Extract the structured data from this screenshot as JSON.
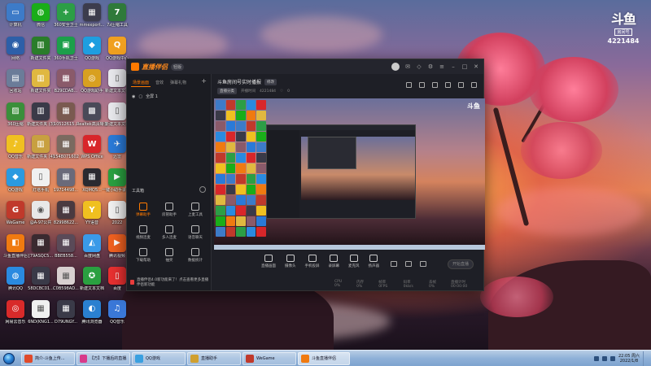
{
  "desktop": {
    "icons": [
      {
        "label": "计算机",
        "color": "#3d7bc8",
        "glyph": "▭"
      },
      {
        "label": "微信",
        "color": "#1aad19",
        "glyph": "◍"
      },
      {
        "label": "360安全卫士",
        "color": "#2c9e46",
        "glyph": "+"
      },
      {
        "label": "mmexport...",
        "color": "#3c3c4c",
        "glyph": "▦"
      },
      {
        "label": "7z压缩工具",
        "color": "#2f7a3a",
        "glyph": "7"
      },
      {
        "label": "网络",
        "color": "#2d5fa8",
        "glyph": "◉"
      },
      {
        "label": "新建文件夹",
        "color": "#2a7d2a",
        "glyph": "▥"
      },
      {
        "label": "360手机卫士",
        "color": "#1c9f4a",
        "glyph": "▣"
      },
      {
        "label": "QQ游戏",
        "color": "#1e9ee0",
        "glyph": "◆"
      },
      {
        "label": "QQ游戏中心",
        "color": "#f0a020",
        "glyph": "Q"
      },
      {
        "label": "回收站",
        "color": "#6b7c99",
        "glyph": "▤"
      },
      {
        "label": "新建文件夹",
        "color": "#e0b840",
        "glyph": "▥"
      },
      {
        "label": "B29CDAB...",
        "color": "#8a5a6a",
        "glyph": "▦"
      },
      {
        "label": "QQ游戏助手",
        "color": "#d8a020",
        "glyph": "◎"
      },
      {
        "label": "新建文本文档",
        "color": "#e8e8ec",
        "glyph": "▯"
      },
      {
        "label": "360压缩",
        "color": "#3a8f3a",
        "glyph": "▨"
      },
      {
        "label": "新建文件夹 (3)",
        "color": "#3a3a48",
        "glyph": "▥"
      },
      {
        "label": "10512615...",
        "color": "#7a5a50",
        "glyph": "▦"
      },
      {
        "label": "Realtek高清晰音频管理器",
        "color": "#4a4a58",
        "glyph": "▩"
      },
      {
        "label": "新建文本文档",
        "color": "#e8e8ec",
        "glyph": "▯"
      },
      {
        "label": "QQ音乐",
        "color": "#f0c020",
        "glyph": "♪"
      },
      {
        "label": "新建文件夹 (4)",
        "color": "#c8a040",
        "glyph": "▥"
      },
      {
        "label": "1548071602",
        "color": "#7a6a60",
        "glyph": "▦"
      },
      {
        "label": "WPS Office",
        "color": "#d8262a",
        "glyph": "W"
      },
      {
        "label": "迅雷",
        "color": "#2a7ad8",
        "glyph": "✈"
      },
      {
        "label": "QQ游戏",
        "color": "#2a9ae0",
        "glyph": "◆"
      },
      {
        "label": "灯塔手机",
        "color": "#f0f0f0",
        "glyph": "▯"
      },
      {
        "label": "19714498...",
        "color": "#6a6a7a",
        "glyph": "▦"
      },
      {
        "label": "XQMQ5...",
        "color": "#2a2a30",
        "glyph": "▦"
      },
      {
        "label": "一键小助手录像视频编辑",
        "color": "#2aa040",
        "glyph": "▶"
      },
      {
        "label": "WeGame",
        "color": "#c0392b",
        "glyph": "G"
      },
      {
        "label": "@A-97公共",
        "color": "#e8e8e8",
        "glyph": "◉"
      },
      {
        "label": "82998622...",
        "color": "#4a3a40",
        "glyph": "▦"
      },
      {
        "label": "YY语音",
        "color": "#f0c020",
        "glyph": "Y"
      },
      {
        "label": "2022",
        "color": "#f0f0f0",
        "glyph": "▯"
      },
      {
        "label": "斗鱼直播伴侣",
        "color": "#f07a10",
        "glyph": "◧"
      },
      {
        "label": "[79ASQC5...",
        "color": "#3a2a30",
        "glyph": "▦"
      },
      {
        "label": "BBEB558...",
        "color": "#5a4a58",
        "glyph": "▦"
      },
      {
        "label": "百度网盘",
        "color": "#3a9ae8",
        "glyph": "◭"
      },
      {
        "label": "腾讯视频",
        "color": "#f06020",
        "glyph": "▶"
      },
      {
        "label": "腾讯QQ",
        "color": "#2a8ae0",
        "glyph": "◍"
      },
      {
        "label": "58DCBC01...",
        "color": "#3a3a48",
        "glyph": "▦"
      },
      {
        "label": "C0B598AD...",
        "color": "#d8d0d0",
        "glyph": "▦"
      },
      {
        "label": "新建文本文档",
        "color": "#2aa040",
        "glyph": "✪"
      },
      {
        "label": "百度",
        "color": "#e83030",
        "glyph": "▯"
      },
      {
        "label": "网易云音乐",
        "color": "#d82a2a",
        "glyph": "◎"
      },
      {
        "label": "6ND(KNG1...",
        "color": "#f0f0f0",
        "glyph": "▦"
      },
      {
        "label": "D79UNGY...",
        "color": "#3a3a48",
        "glyph": "▦"
      },
      {
        "label": "腾讯浏览器",
        "color": "#2a80d0",
        "glyph": "◐"
      },
      {
        "label": "QQ音乐",
        "color": "#3a78d8",
        "glyph": "♫"
      }
    ]
  },
  "douyu": {
    "logo": "斗鱼",
    "room_tag": "房间号",
    "room_id": "4221484"
  },
  "app": {
    "title": "直播伴侣",
    "version_badge": "轻版",
    "tabs": [
      "场景画面",
      "音效",
      "弹幕礼物"
    ],
    "tab_add": "+",
    "scene_item": "全屏 1",
    "toolbox_label": "工具箱",
    "tools": [
      {
        "label": "弹幕助手",
        "hot": true
      },
      {
        "label": "房管助手",
        "hot": false
      },
      {
        "label": "上麦工具",
        "hot": false
      },
      {
        "label": "视频连麦",
        "hot": false
      },
      {
        "label": "多人连麦",
        "hot": false
      },
      {
        "label": "语音聊天",
        "hot": false
      },
      {
        "label": "下载帮助",
        "hot": false
      },
      {
        "label": "抽奖",
        "hot": false
      },
      {
        "label": "数据统计",
        "hot": false
      }
    ],
    "notice": "直播伴侣4.0新功能来了！点击查看更多直播伴侣新功能",
    "room_title": "斗鱼房间号实时播报",
    "edit_label": "修改",
    "category": "直播分类",
    "meta_text": "开播时间",
    "room_number": "4221484",
    "viewers": "0",
    "controls": [
      "直播画面",
      "摄像头",
      "手机投屏",
      "录屏幕",
      "麦克风",
      "扬声器"
    ],
    "start_button": "开始直播",
    "status": [
      "CPU 0%",
      "内存 0%",
      "帧率 0FPS",
      "码率 0kb/s",
      "丢帧 0%",
      "直播计时 00:00:00"
    ]
  },
  "taskbar": {
    "items": [
      {
        "label": "简介-斗鱼上传...",
        "color": "#e04a2a",
        "active": false
      },
      {
        "label": "【万】下播后的直播...",
        "color": "#d83a8a",
        "active": false
      },
      {
        "label": "QQ游戏",
        "color": "#3aa0e0",
        "active": false
      },
      {
        "label": "直播助手",
        "color": "#d0a030",
        "active": false
      },
      {
        "label": "WeGame",
        "color": "#c0392b",
        "active": false
      },
      {
        "label": "斗鱼直播伴侣",
        "color": "#f07a10",
        "active": true
      }
    ],
    "time": "22:05",
    "weekday": "周六",
    "date": "2022/1/8"
  }
}
